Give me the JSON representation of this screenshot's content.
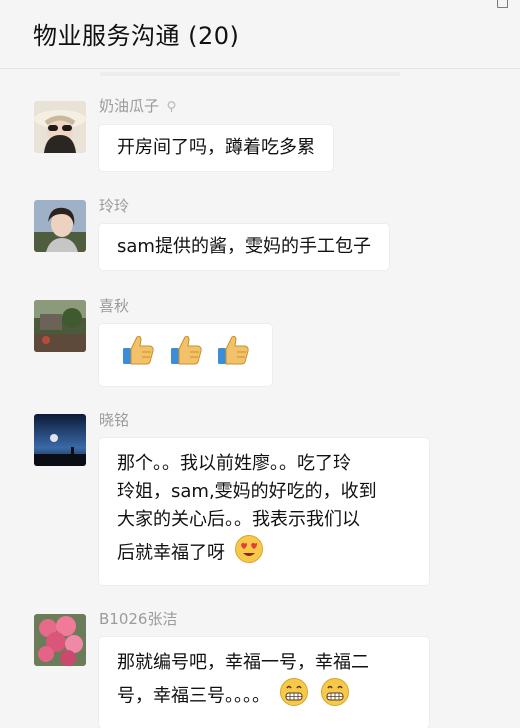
{
  "window": {
    "title": "物业服务沟通 (20)",
    "minimize": "−",
    "maximize": "□"
  },
  "messages": [
    {
      "sender": "奶油瓜子",
      "text": "开房间了吗，蹲着吃多累"
    },
    {
      "sender": "玲玲",
      "text": "sam提供的酱，雯妈的手工包子"
    },
    {
      "sender": "喜秋",
      "text": "",
      "emojis": [
        "thumbs-up",
        "thumbs-up",
        "thumbs-up"
      ]
    },
    {
      "sender": "晓铭",
      "lines": [
        "那个。。我以前姓廖。。吃了玲",
        "玲姐，sam,雯妈的好吃的，收到",
        "大家的关心后。。我表示我们以",
        "后就幸福了呀"
      ],
      "emoji": "heart-eyes-face"
    },
    {
      "sender": "B1026张洁",
      "lines": [
        "那就编号吧，幸福一号，幸福二",
        "号，幸福三号。。。。"
      ],
      "emojis": [
        "grinning-face",
        "grinning-face"
      ]
    }
  ],
  "colors": {
    "background": "#f5f5f5",
    "bubble": "#ffffff",
    "name": "#9b9b9b"
  }
}
